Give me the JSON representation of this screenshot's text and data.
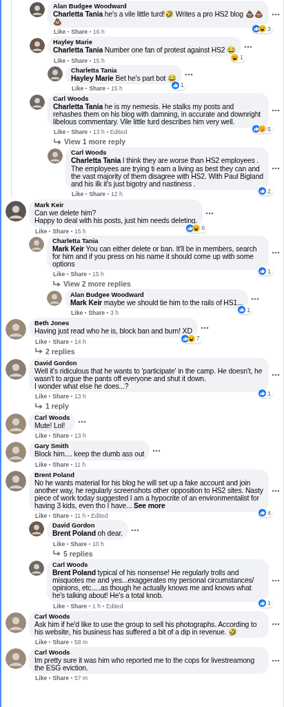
{
  "thread_tail": [
    {
      "author": "Alan Budgee Woodward",
      "mention": "Charletta Tania",
      "text": "he's a vile little turd!🤣 Writes a pro HS2 blog 💩💩💩",
      "actions": [
        "Like",
        "Share"
      ],
      "time": "16 h",
      "reactions": {
        "icons": [
          {
            "kind": "like"
          },
          {
            "kind": "haha"
          }
        ],
        "count": "3"
      }
    },
    {
      "author": "Hayley Marie",
      "mention": "Charletta Tania",
      "text": "Number one fan of protest against HS2 😂",
      "actions": [
        "Like",
        "Share"
      ],
      "time": "15 h",
      "reactions": {
        "icons": [
          {
            "kind": "haha"
          }
        ],
        "count": "1"
      },
      "replies": [
        {
          "author": "Charletta Tania",
          "mention": "Hayley Marie",
          "text": "Bet he's part bot 😂",
          "actions": [
            "Like",
            "Share"
          ],
          "time": "15 h",
          "reactions": {
            "icons": [
              {
                "kind": "like"
              }
            ],
            "count": "1"
          }
        }
      ]
    },
    {
      "author": "Carl Woods",
      "mention": "Charletta Tania",
      "text": "he is my nemesis. He stalks my posts and rehashes them on his blog with damning, in accurate and downright libelous commentary. Vile little turd describes him very well.",
      "actions": [
        "Like",
        "Share"
      ],
      "time": "13 h",
      "note": "Edited",
      "reactions": {
        "icons": [
          {
            "kind": "like"
          },
          {
            "kind": "care"
          }
        ],
        "count": "5"
      },
      "more_replies": "View 1 more reply",
      "replies": [
        {
          "author": "Carl Woods",
          "mention": "Charletta Tania",
          "text": "I think they are worse than HS2 employees . The employees are trying ti earn a living as best they can and the vast majority of them disagree with HS2. With Paul Bigland and his ilk it's just bigotry and nastiness .",
          "actions": [
            "Like",
            "Share"
          ],
          "time": "12 h",
          "reactions": {
            "icons": [
              {
                "kind": "like"
              }
            ],
            "count": "2"
          }
        }
      ]
    }
  ],
  "comments": [
    {
      "author": "Mark Keir",
      "text": "Can we delete him?\nHappy to deal with his posts, just him needs deleting.",
      "actions": [
        "Like",
        "Share"
      ],
      "time": "15 h",
      "reactions": {
        "icons": [
          {
            "kind": "like"
          },
          {
            "kind": "haha"
          }
        ],
        "count": "6"
      },
      "replies": [
        {
          "author": "Charletta Tania",
          "mention": "Mark Keir",
          "text": "You can either delete or ban. It'll be in members, search for him and if you press on his name it should come up with some options",
          "actions": [
            "Like",
            "Share"
          ],
          "time": "15 h",
          "reactions": {
            "icons": [
              {
                "kind": "like"
              }
            ],
            "count": "1"
          },
          "more_replies": "View 2 more replies",
          "replies": [
            {
              "author": "Alan Budgee Woodward",
              "mention": "Mark Keir",
              "text": "maybe we should tie him to the rails of HS1...",
              "actions": [
                "Like",
                "Share"
              ],
              "time": "3 h",
              "reactions": {
                "icons": [
                  {
                    "kind": "like"
                  }
                ],
                "count": "1"
              }
            }
          ]
        }
      ]
    },
    {
      "author": "Beth Jones",
      "text": "Having just read who he is, block ban and burn! XD",
      "actions": [
        "Like",
        "Share"
      ],
      "time": "14 h",
      "reactions": {
        "icons": [
          {
            "kind": "like"
          },
          {
            "kind": "haha"
          }
        ],
        "count": "7"
      },
      "more_replies": "2 replies"
    },
    {
      "author": "David Gordon",
      "text": "Well it's ridiculous that he wants to 'participate' in the camp. He doesn't, he wasn't to argue the pants off everyone and shut it down.\nI wonder what else he does...?",
      "actions": [
        "Like",
        "Share"
      ],
      "time": "13 h",
      "reactions": {
        "icons": [
          {
            "kind": "like"
          }
        ],
        "count": "1"
      },
      "more_replies": "1 reply"
    },
    {
      "author": "Carl Woods",
      "text": "Mute! Lol!",
      "actions": [
        "Like",
        "Share"
      ],
      "time": "13 h"
    },
    {
      "author": "Gary Smith",
      "text": "Block him.... keep the dumb ass out",
      "actions": [
        "Like",
        "Share"
      ],
      "time": "11 h"
    },
    {
      "author": "Brent Poland",
      "text": "No he wants material for his blog he will set up a fake account and join another way, he regularly screenshots other opposition to HS2 sites. Nasty piece of work today suggested I am a hypocrite of an environmentalist for having 3 kids, even tho I have...",
      "see_more": "See more",
      "actions": [
        "Like",
        "Share"
      ],
      "time": "11 h",
      "note": "Edited",
      "reactions": {
        "icons": [
          {
            "kind": "like"
          }
        ],
        "count": "4"
      },
      "replies": [
        {
          "author": "David Gordon",
          "mention": "Brent Poland",
          "text": "oh dear.",
          "actions": [
            "Like",
            "Share"
          ],
          "time": "10 h",
          "more_replies": "5 replies"
        },
        {
          "author": "Carl Woods",
          "mention": "Brent Poland",
          "text": "typical of his nonsense! He regularly trolls and misquotes me and yes...exaggerates my personal circumstances/ opinions, etc.....as though he actually knows me and knows what he's talking about! He's a total knob.",
          "actions": [
            "Like",
            "Share"
          ],
          "time": "1 h",
          "note": "Edited",
          "reactions": {
            "icons": [
              {
                "kind": "like"
              }
            ],
            "count": "1"
          }
        }
      ]
    },
    {
      "author": "Carl Woods",
      "text": "Ask him if he'd like to use the group to sell his photographs. According to his website, his business has suffered a bit of a dip in revenue. 🤣",
      "actions": [
        "Like",
        "Share"
      ],
      "time": "58 m"
    },
    {
      "author": "Carl Woods",
      "text": "Im pretty sure it was him who reported me to the cops for livestreamong the ESG eviction.",
      "actions": [
        "Like",
        "Share"
      ],
      "time": "57 m"
    }
  ]
}
